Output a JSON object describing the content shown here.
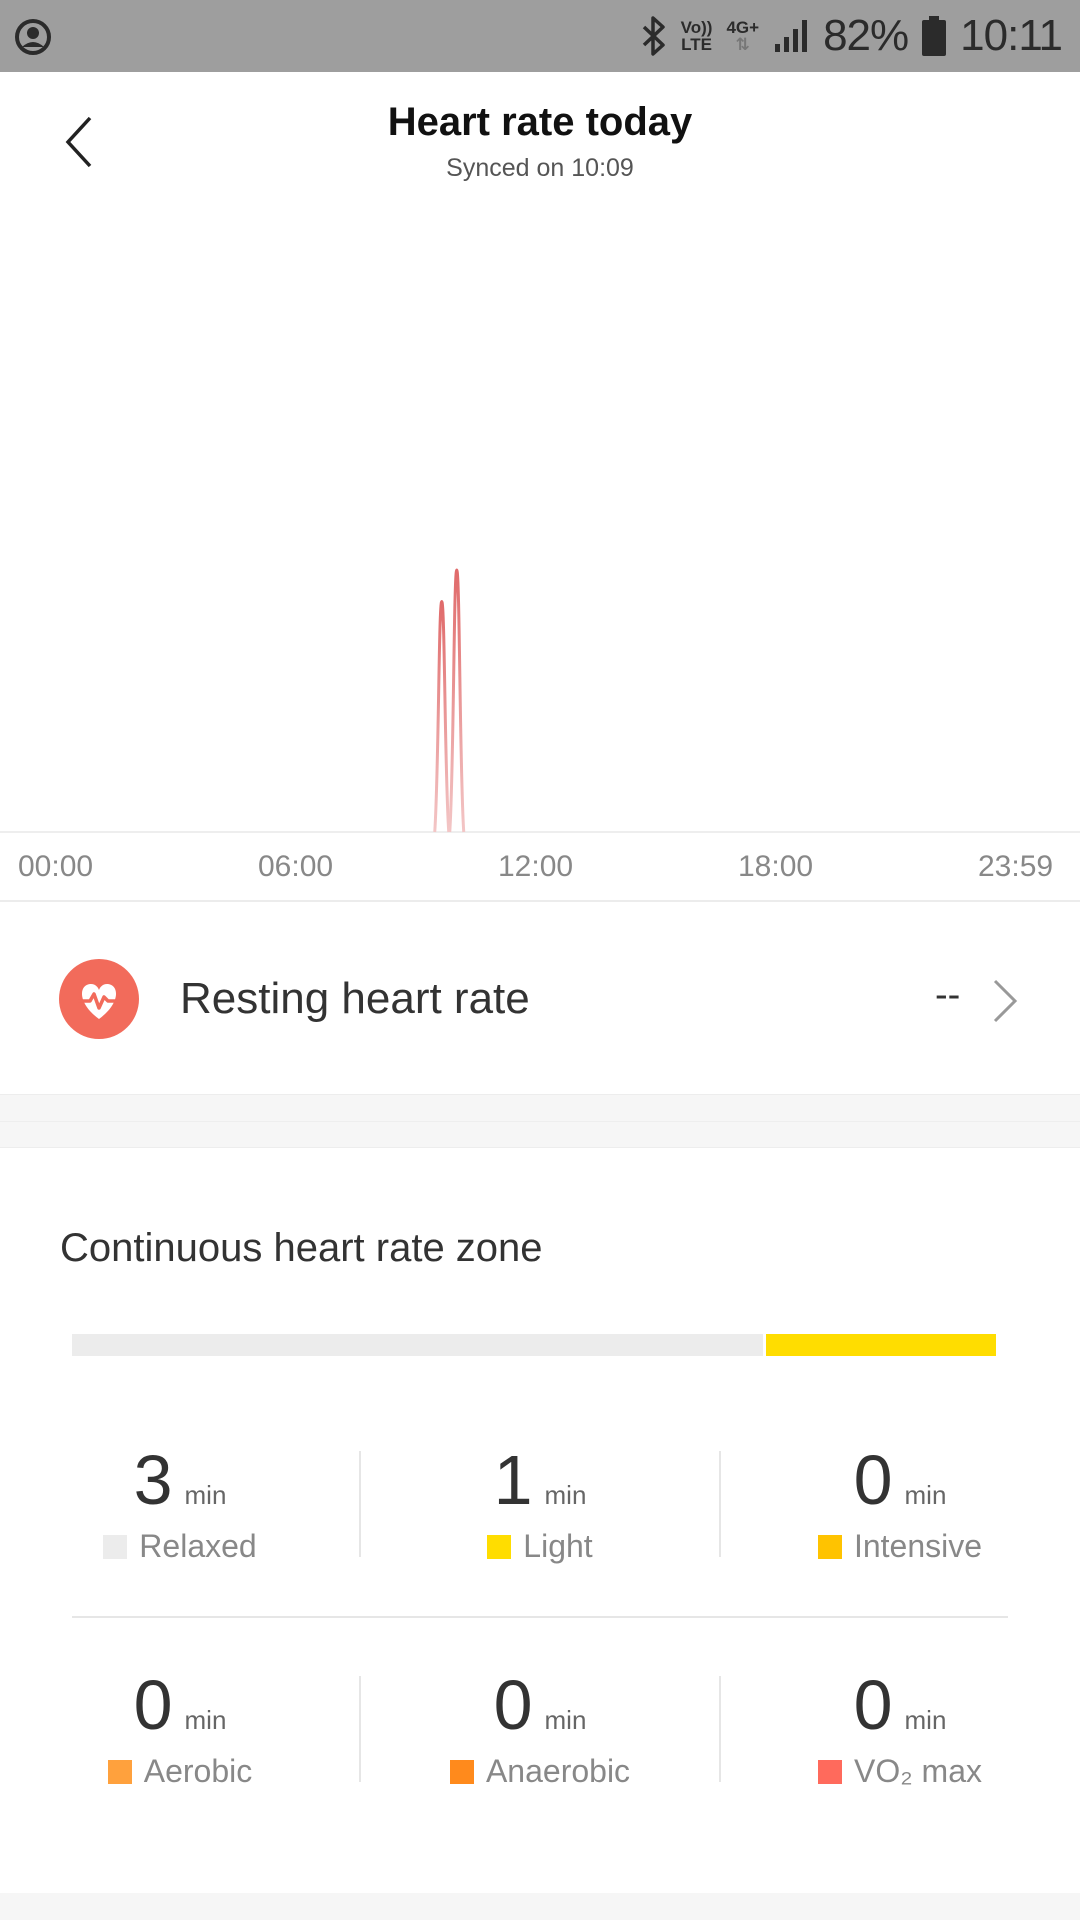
{
  "status_bar": {
    "battery": "82%",
    "time": "10:11",
    "volte_top": "Vo))",
    "volte_bottom": "LTE",
    "network": "4G+",
    "network_arrows": "⇅",
    "icons": [
      "account-circle-icon",
      "bluetooth-icon",
      "volte-icon",
      "4g-icon",
      "signal-icon",
      "battery-icon"
    ]
  },
  "header": {
    "title": "Heart rate today",
    "subtitle": "Synced on 10:09",
    "back_icon": "chevron-left-icon"
  },
  "chart_data": {
    "type": "line",
    "x_ticks": [
      "00:00",
      "06:00",
      "12:00",
      "18:00",
      "23:59"
    ],
    "series": [
      {
        "values": [
          {
            "x": "09:49",
            "y": 0.88
          },
          {
            "x": "10:09",
            "y": 1.0
          }
        ],
        "color": "#e57373"
      }
    ]
  },
  "resting": {
    "label": "Resting heart rate",
    "value": "--",
    "icon": "heart-pulse-icon",
    "icon_color": "#f26b5b"
  },
  "zones": {
    "title": "Continuous heart rate zone",
    "bar": [
      {
        "name": "Relaxed",
        "minutes": 3,
        "color": "#ececec"
      },
      {
        "name": "Light",
        "minutes": 1,
        "color": "#ffdd00"
      }
    ],
    "items": [
      {
        "value": "3",
        "unit": "min",
        "label": "Relaxed",
        "color": "#ececec"
      },
      {
        "value": "1",
        "unit": "min",
        "label": "Light",
        "color": "#ffdd00"
      },
      {
        "value": "0",
        "unit": "min",
        "label": "Intensive",
        "color": "#ffc300"
      },
      {
        "value": "0",
        "unit": "min",
        "label": "Aerobic",
        "color": "#ffa13d"
      },
      {
        "value": "0",
        "unit": "min",
        "label": "Anaerobic",
        "color": "#ff8a1c"
      },
      {
        "value": "0",
        "unit": "min",
        "label": "VO₂ max",
        "color": "#ff6a5c"
      }
    ]
  }
}
